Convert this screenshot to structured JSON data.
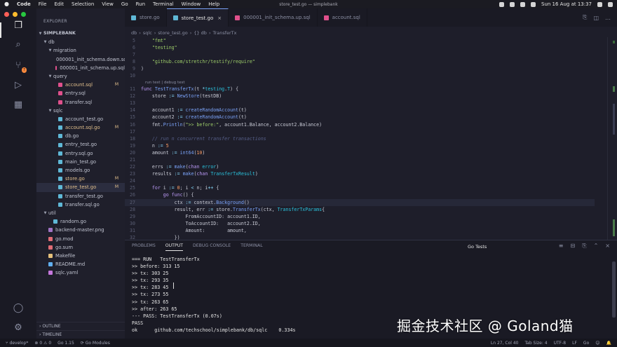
{
  "menubar": {
    "apple": "",
    "items": [
      "Code",
      "File",
      "Edit",
      "Selection",
      "View",
      "Go",
      "Run",
      "Terminal",
      "Window",
      "Help"
    ],
    "window_title": "store_test.go — simplebank",
    "clock": "Sun 16 Aug at 13:37"
  },
  "activity": {
    "badge": "7",
    "icons": [
      "files-icon",
      "search-icon",
      "source-control-icon",
      "run-debug-icon",
      "extensions-icon",
      "account-icon",
      "settings-gear-icon"
    ]
  },
  "sidebar": {
    "title": "EXPLORER",
    "project": "SIMPLEBANK",
    "tree": [
      {
        "label": "db",
        "type": "folder",
        "depth": 1,
        "open": true
      },
      {
        "label": "migration",
        "type": "folder",
        "depth": 2,
        "open": true
      },
      {
        "label": "000001_init_schema.down.sql",
        "type": "sql",
        "depth": 3
      },
      {
        "label": "000001_init_schema.up.sql",
        "type": "sql",
        "depth": 3
      },
      {
        "label": "query",
        "type": "folder",
        "depth": 2,
        "open": true
      },
      {
        "label": "account.sql",
        "type": "sql",
        "depth": 3,
        "git": "M"
      },
      {
        "label": "entry.sql",
        "type": "sql",
        "depth": 3
      },
      {
        "label": "transfer.sql",
        "type": "sql",
        "depth": 3
      },
      {
        "label": "sqlc",
        "type": "folder",
        "depth": 2,
        "open": true
      },
      {
        "label": "account_test.go",
        "type": "go",
        "depth": 3
      },
      {
        "label": "account.sql.go",
        "type": "go",
        "depth": 3,
        "git": "M"
      },
      {
        "label": "db.go",
        "type": "go",
        "depth": 3
      },
      {
        "label": "entry_test.go",
        "type": "go",
        "depth": 3
      },
      {
        "label": "entry.sql.go",
        "type": "go",
        "depth": 3
      },
      {
        "label": "main_test.go",
        "type": "go",
        "depth": 3
      },
      {
        "label": "models.go",
        "type": "go",
        "depth": 3
      },
      {
        "label": "store.go",
        "type": "go",
        "depth": 3,
        "git": "M"
      },
      {
        "label": "store_test.go",
        "type": "go",
        "depth": 3,
        "git": "M",
        "selected": true
      },
      {
        "label": "transfer_test.go",
        "type": "go",
        "depth": 3
      },
      {
        "label": "transfer.sql.go",
        "type": "go",
        "depth": 3
      },
      {
        "label": "util",
        "type": "folder",
        "depth": 1,
        "open": true
      },
      {
        "label": "random.go",
        "type": "go",
        "depth": 2
      },
      {
        "label": "backend-master.png",
        "type": "png",
        "depth": 1
      },
      {
        "label": "go.mod",
        "type": "mod",
        "depth": 1
      },
      {
        "label": "go.sum",
        "type": "mod",
        "depth": 1
      },
      {
        "label": "Makefile",
        "type": "make",
        "depth": 1
      },
      {
        "label": "README.md",
        "type": "md",
        "depth": 1
      },
      {
        "label": "sqlc.yaml",
        "type": "yaml",
        "depth": 1
      }
    ],
    "outline": "OUTLINE",
    "timeline": "TIMELINE"
  },
  "tabs": [
    {
      "label": "store.go",
      "icon": "go",
      "active": false
    },
    {
      "label": "store_test.go",
      "icon": "go",
      "active": true,
      "close": "×"
    },
    {
      "label": "000001_init_schema.up.sql",
      "icon": "sql",
      "active": false
    },
    {
      "label": "account.sql",
      "icon": "sql",
      "active": false
    }
  ],
  "breadcrumb": [
    "db",
    "sqlc",
    "store_test.go",
    "{} db",
    "TransferTx"
  ],
  "breadcrumb_sep": "›",
  "code": [
    {
      "n": "5",
      "html": "    <span class='str'>\"fmt\"</span>"
    },
    {
      "n": "6",
      "html": "    <span class='str'>\"testing\"</span>"
    },
    {
      "n": "7",
      "html": ""
    },
    {
      "n": "8",
      "html": "    <span class='str'>\"github.com/stretchr/testify/require\"</span>"
    },
    {
      "n": "9",
      "html": ")"
    },
    {
      "n": "10",
      "html": ""
    },
    {
      "lens": true,
      "html": "run test | debug test"
    },
    {
      "n": "11",
      "html": "<span class='kw'>func</span> <span class='fn'>TestTransferTx</span>(t <span class='op'>*</span><span class='ty'>testing</span>.<span class='ty'>T</span>) {"
    },
    {
      "n": "12",
      "html": "    store <span class='op'>:=</span> <span class='fn'>NewStore</span>(testDB)"
    },
    {
      "n": "13",
      "html": ""
    },
    {
      "n": "14",
      "html": "    account1 <span class='op'>:=</span> <span class='fn'>createRandomAccount</span>(t)"
    },
    {
      "n": "15",
      "html": "    account2 <span class='op'>:=</span> <span class='fn'>createRandomAccount</span>(t)"
    },
    {
      "n": "16",
      "html": "    fmt.<span class='fn'>Println</span>(<span class='str'>\">> before:\"</span>, account1.Balance, account2.Balance)"
    },
    {
      "n": "17",
      "html": ""
    },
    {
      "n": "18",
      "html": "    <span class='cmt'>// run n concurrent transfer transactions</span>"
    },
    {
      "n": "19",
      "html": "    n <span class='op'>:=</span> <span class='num'>5</span>"
    },
    {
      "n": "20",
      "html": "    amount <span class='op'>:=</span> <span class='fn'>int64</span>(<span class='num'>10</span>)"
    },
    {
      "n": "21",
      "html": ""
    },
    {
      "n": "22",
      "html": "    errs <span class='op'>:=</span> <span class='fn'>make</span>(<span class='kw'>chan</span> <span class='ty'>error</span>)"
    },
    {
      "n": "23",
      "html": "    results <span class='op'>:=</span> <span class='fn'>make</span>(<span class='kw'>chan</span> <span class='ty'>TransferTxResult</span>)"
    },
    {
      "n": "24",
      "html": ""
    },
    {
      "n": "25",
      "html": "    <span class='kw'>for</span> i <span class='op'>:=</span> <span class='num'>0</span>; i <span class='op'>&lt;</span> n; i<span class='op'>++</span> {"
    },
    {
      "n": "26",
      "html": "        <span class='kw'>go</span> <span class='kw'>func</span>() {"
    },
    {
      "n": "27",
      "html": "            ctx <span class='op'>:=</span> context.<span class='fn'>Background</span>()",
      "current": true
    },
    {
      "n": "28",
      "html": "            result, err <span class='op'>:=</span> store.<span class='fn'>TransferTx</span>(ctx, <span class='ty'>TransferTxParams</span>{"
    },
    {
      "n": "29",
      "html": "                FromAccountID: account1.ID,"
    },
    {
      "n": "30",
      "html": "                ToAccountID:   account2.ID,"
    },
    {
      "n": "31",
      "html": "                Amount:        amount,"
    },
    {
      "n": "32",
      "html": "            })"
    }
  ],
  "panel": {
    "tabs": [
      "PROBLEMS",
      "OUTPUT",
      "DEBUG CONSOLE",
      "TERMINAL"
    ],
    "active_tab": "OUTPUT",
    "channel": "Go Tests",
    "output": [
      "=== RUN   TestTransferTx",
      ">> before: 313 15",
      ">> tx: 303 25",
      ">> tx: 293 35",
      ">> tx: 283 45",
      ">> tx: 273 55",
      ">> tx: 263 65",
      ">> after: 263 65",
      "--- PASS: TestTransferTx (0.07s)",
      "PASS",
      "ok      github.com/techschool/simplebank/db/sqlc    0.334s"
    ]
  },
  "statusbar": {
    "branch": "develop*",
    "problems": "⊗ 0 ⚠ 0",
    "go_version": "Go 1.15",
    "go_modules": "Go Modules",
    "position": "Ln 27, Col 40",
    "tab_size": "Tab Size: 4",
    "encoding": "UTF-8",
    "eol": "LF",
    "language": "Go"
  },
  "watermark": "掘金技术社区 @ Goland猫",
  "colors": {
    "accent": "#7aa2f7",
    "modified": "#e2c08d",
    "go_icon": "#5fb8d6",
    "sql_icon": "#e0508c",
    "folder_icon": "#c0c2cf",
    "traffic_red": "#ff5f57",
    "traffic_yellow": "#febc2e",
    "traffic_green": "#28c840"
  }
}
